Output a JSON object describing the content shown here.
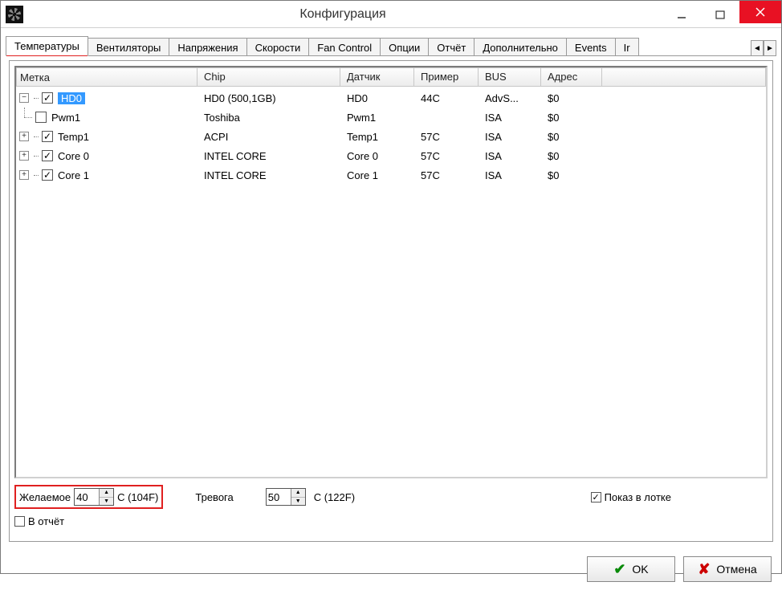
{
  "window": {
    "title": "Конфигурация"
  },
  "tabs": [
    {
      "label": "Температуры",
      "active": true
    },
    {
      "label": "Вентиляторы"
    },
    {
      "label": "Напряжения"
    },
    {
      "label": "Скорости"
    },
    {
      "label": "Fan Control"
    },
    {
      "label": "Опции"
    },
    {
      "label": "Отчёт"
    },
    {
      "label": "Дополнительно"
    },
    {
      "label": "Events"
    },
    {
      "label": "Ir"
    }
  ],
  "columns": {
    "label": "Метка",
    "chip": "Chip",
    "sensor": "Датчик",
    "sample": "Пример",
    "bus": "BUS",
    "addr": "Адрес"
  },
  "rows": [
    {
      "indent": 0,
      "toggle": "-",
      "checked": true,
      "selected": true,
      "label": "HD0",
      "chip": "HD0 (500,1GB)",
      "sensor": "HD0",
      "sample": "44C",
      "bus": "AdvS...",
      "addr": "$0"
    },
    {
      "indent": 1,
      "toggle": "",
      "checked": false,
      "label": "Pwm1",
      "chip": "Toshiba",
      "sensor": "Pwm1",
      "sample": "",
      "bus": "ISA",
      "addr": "$0"
    },
    {
      "indent": 0,
      "toggle": "+",
      "checked": true,
      "label": "Temp1",
      "chip": "ACPI",
      "sensor": "Temp1",
      "sample": "57C",
      "bus": "ISA",
      "addr": "$0"
    },
    {
      "indent": 0,
      "toggle": "+",
      "checked": true,
      "label": "Core 0",
      "chip": "INTEL CORE",
      "sensor": "Core 0",
      "sample": "57C",
      "bus": "ISA",
      "addr": "$0"
    },
    {
      "indent": 0,
      "toggle": "+",
      "checked": true,
      "label": "Core 1",
      "chip": "INTEL CORE",
      "sensor": "Core 1",
      "sample": "57C",
      "bus": "ISA",
      "addr": "$0"
    }
  ],
  "controls": {
    "desired_label": "Желаемое",
    "desired_value": "40",
    "desired_unit": "C (104F)",
    "alarm_label": "Тревога",
    "alarm_value": "50",
    "alarm_unit": "C (122F)",
    "tray_label": "Показ в лотке",
    "tray_checked": true,
    "report_label": "В отчёт",
    "report_checked": false
  },
  "buttons": {
    "ok": "OK",
    "cancel": "Отмена"
  }
}
